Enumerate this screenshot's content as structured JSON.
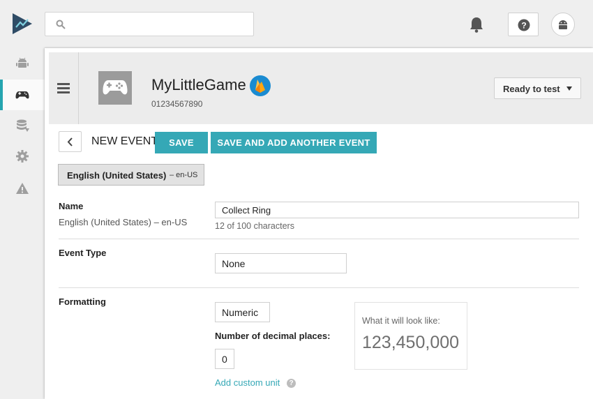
{
  "topbar": {
    "search_placeholder": "",
    "icons": [
      "play-console-logo-icon",
      "search-icon",
      "bell-icon",
      "help-icon",
      "android-avatar-icon"
    ]
  },
  "leftnav": {
    "items": [
      {
        "icon": "android-icon",
        "active": false
      },
      {
        "icon": "gamepad-icon",
        "active": true
      },
      {
        "icon": "database-icon",
        "active": false
      },
      {
        "icon": "gear-icon",
        "active": false
      },
      {
        "icon": "warning-icon",
        "active": false
      }
    ]
  },
  "app": {
    "name": "MyLittleGame",
    "id": "01234567890",
    "status_button": "Ready to test"
  },
  "event": {
    "title": "NEW EVENT",
    "save_label": "SAVE",
    "save_add_label": "SAVE AND ADD ANOTHER EVENT"
  },
  "language_tab": {
    "name": "English (United States)",
    "code": "– en-US"
  },
  "fields": {
    "name": {
      "label": "Name",
      "sublabel": "English (United States) – en-US",
      "value": "Collect Ring",
      "hint": "12 of 100 characters"
    },
    "event_type": {
      "label": "Event Type",
      "value": "None"
    },
    "formatting": {
      "label": "Formatting",
      "value": "Numeric",
      "decimal_label": "Number of decimal places:",
      "decimal_value": "0",
      "preview_label": "What it will look like:",
      "preview_value": "123,450,000",
      "add_unit_link": "Add custom unit",
      "help_glyph": "?"
    }
  },
  "colors": {
    "accent": "#35a8b6",
    "active_bar": "#26a5b0",
    "header_bg": "#ececec",
    "firebase_badge": "#1a8bd1"
  }
}
